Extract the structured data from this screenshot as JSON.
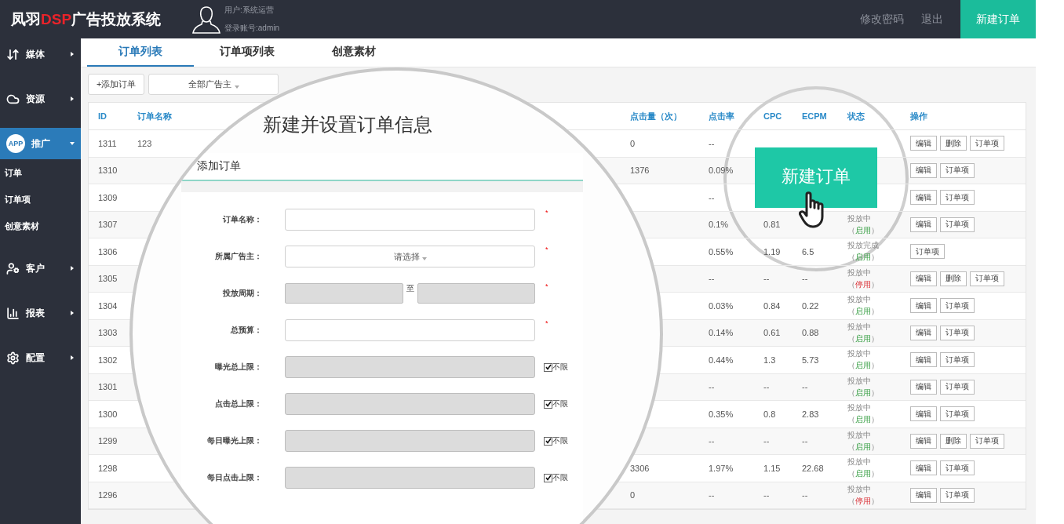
{
  "header": {
    "logo": {
      "before": "凤羽",
      "accent": "DSP",
      "after": "广告投放系统"
    },
    "user": "用户:系统运营",
    "account": "登录账号:admin",
    "links": [
      "修改密码",
      "退出"
    ],
    "primary_button": "新建订单"
  },
  "sidebar": {
    "items": [
      {
        "label": "媒体",
        "selected": false,
        "expanded": false
      },
      {
        "label": "资源",
        "selected": false,
        "expanded": false
      },
      {
        "label": "推广",
        "badge": "APP",
        "selected": true,
        "expanded": true,
        "children": [
          {
            "label": "订单",
            "selected": false
          },
          {
            "label": "订单项",
            "selected": false
          },
          {
            "label": "创意素材",
            "selected": false
          }
        ]
      },
      {
        "label": "客户",
        "selected": false,
        "expanded": false
      },
      {
        "label": "报表",
        "selected": false,
        "expanded": false
      },
      {
        "label": "配置",
        "selected": false,
        "expanded": false
      }
    ]
  },
  "tabs": [
    {
      "label": "订单列表",
      "selected": true
    },
    {
      "label": "订单项列表",
      "selected": false
    },
    {
      "label": "创意素材",
      "selected": false
    }
  ],
  "toolbar": {
    "add_button": "+添加订单",
    "advertiser_dropdown": "全部广告主"
  },
  "table": {
    "columns": {
      "id": "ID",
      "name": "订单名称",
      "clicks": "点击量（次）",
      "ctr": "点击率",
      "cpc": "CPC",
      "ecpm": "ECPM",
      "status": "状态",
      "actions": "操作"
    },
    "rows": [
      {
        "id": "1311",
        "name": "123",
        "clicks": "0",
        "ctr": "--",
        "actions": [
          "编辑",
          "删除",
          "订单项"
        ]
      },
      {
        "id": "1310",
        "clicks": "1376",
        "ctr": "0.09%",
        "actions": [
          "编辑",
          "订单项"
        ]
      },
      {
        "id": "1309",
        "ctr": "--",
        "actions": [
          "编辑",
          "订单项"
        ]
      },
      {
        "id": "1307",
        "ctr": "0.1%",
        "cpc": "0.81",
        "status": {
          "text": "投放中",
          "open": "（",
          "label": "启用",
          "close": "）",
          "enabled": true
        },
        "actions": [
          "编辑",
          "订单项"
        ]
      },
      {
        "id": "1306",
        "ctr": "0.55%",
        "cpc": "1.19",
        "ecpm": "6.5",
        "status": {
          "text": "投放完成",
          "open": "（",
          "label": "启用",
          "close": "）",
          "enabled": true
        },
        "actions": [
          "订单项"
        ]
      },
      {
        "id": "1305",
        "ctr": "--",
        "cpc": "--",
        "ecpm": "--",
        "status": {
          "text": "投放中",
          "open": "（",
          "label": "停用",
          "close": "）",
          "enabled": false
        },
        "actions": [
          "编辑",
          "删除",
          "订单项"
        ]
      },
      {
        "id": "1304",
        "ctr": "0.03%",
        "cpc": "0.84",
        "ecpm": "0.22",
        "status": {
          "text": "投放中",
          "open": "（",
          "label": "启用",
          "close": "）",
          "enabled": true
        },
        "actions": [
          "编辑",
          "订单项"
        ]
      },
      {
        "id": "1303",
        "ctr": "0.14%",
        "cpc": "0.61",
        "ecpm": "0.88",
        "status": {
          "text": "投放中",
          "open": "（",
          "label": "启用",
          "close": "）",
          "enabled": true
        },
        "actions": [
          "编辑",
          "订单项"
        ]
      },
      {
        "id": "1302",
        "ctr": "0.44%",
        "cpc": "1.3",
        "ecpm": "5.73",
        "status": {
          "text": "投放中",
          "open": "（",
          "label": "启用",
          "close": "）",
          "enabled": true
        },
        "actions": [
          "编辑",
          "订单项"
        ]
      },
      {
        "id": "1301",
        "ctr": "--",
        "cpc": "--",
        "ecpm": "--",
        "status": {
          "text": "投放中",
          "open": "（",
          "label": "启用",
          "close": "）",
          "enabled": true
        },
        "actions": [
          "编辑",
          "订单项"
        ]
      },
      {
        "id": "1300",
        "ctr": "0.35%",
        "cpc": "0.8",
        "ecpm": "2.83",
        "status": {
          "text": "投放中",
          "open": "（",
          "label": "启用",
          "close": "）",
          "enabled": true
        },
        "actions": [
          "编辑",
          "订单项"
        ]
      },
      {
        "id": "1299",
        "ctr": "--",
        "cpc": "--",
        "ecpm": "--",
        "status": {
          "text": "投放中",
          "open": "（",
          "label": "启用",
          "close": "）",
          "enabled": true
        },
        "actions": [
          "编辑",
          "删除",
          "订单项"
        ]
      },
      {
        "id": "1298",
        "clicks": "3306",
        "ctr": "1.97%",
        "cpc": "1.15",
        "ecpm": "22.68",
        "status": {
          "text": "投放中",
          "open": "（",
          "label": "启用",
          "close": "）",
          "enabled": true
        },
        "actions": [
          "编辑",
          "订单项"
        ]
      },
      {
        "id": "1296",
        "clicks": "0",
        "ctr": "--",
        "cpc": "--",
        "ecpm": "--",
        "status": {
          "text": "投放中",
          "open": "（",
          "label": "停用",
          "close": "）",
          "enabled": false
        },
        "actions": [
          "编辑",
          "订单项"
        ]
      }
    ]
  },
  "magnifier": {
    "title": "新建并设置订单信息",
    "form": {
      "title": "添加订单",
      "fields": [
        {
          "kind": "text",
          "label": "订单名称：",
          "required_mark": "*",
          "disabled": false
        },
        {
          "kind": "select",
          "label": "所属广告主：",
          "value": "请选择",
          "required_mark": "*",
          "disabled": false
        },
        {
          "kind": "range",
          "label": "投放周期：",
          "separator": "至",
          "required_mark": "*",
          "disabled": true
        },
        {
          "kind": "text",
          "label": "总预算：",
          "required_mark": "*",
          "disabled": false
        },
        {
          "kind": "limit",
          "label": "曝光总上限：",
          "disabled": true,
          "option": {
            "label": "不限",
            "checked": true
          }
        },
        {
          "kind": "limit",
          "label": "点击总上限：",
          "disabled": true,
          "option": {
            "label": "不限",
            "checked": true
          }
        },
        {
          "kind": "limit",
          "label": "每日曝光上限：",
          "disabled": true,
          "option": {
            "label": "不限",
            "checked": true
          }
        },
        {
          "kind": "limit",
          "label": "每日点击上限：",
          "disabled": true,
          "option": {
            "label": "不限",
            "checked": true
          }
        }
      ]
    }
  },
  "callout": {
    "button": "新建订单"
  }
}
